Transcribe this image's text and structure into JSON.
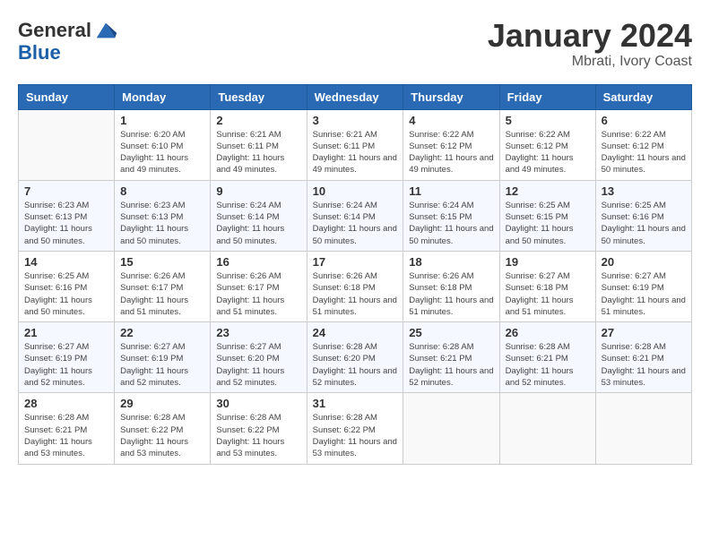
{
  "logo": {
    "general": "General",
    "blue": "Blue"
  },
  "header": {
    "month_year": "January 2024",
    "location": "Mbrati, Ivory Coast"
  },
  "weekdays": [
    "Sunday",
    "Monday",
    "Tuesday",
    "Wednesday",
    "Thursday",
    "Friday",
    "Saturday"
  ],
  "weeks": [
    [
      {
        "day": "",
        "sunrise": "",
        "sunset": "",
        "daylight": ""
      },
      {
        "day": "1",
        "sunrise": "6:20 AM",
        "sunset": "6:10 PM",
        "daylight": "11 hours and 49 minutes."
      },
      {
        "day": "2",
        "sunrise": "6:21 AM",
        "sunset": "6:11 PM",
        "daylight": "11 hours and 49 minutes."
      },
      {
        "day": "3",
        "sunrise": "6:21 AM",
        "sunset": "6:11 PM",
        "daylight": "11 hours and 49 minutes."
      },
      {
        "day": "4",
        "sunrise": "6:22 AM",
        "sunset": "6:12 PM",
        "daylight": "11 hours and 49 minutes."
      },
      {
        "day": "5",
        "sunrise": "6:22 AM",
        "sunset": "6:12 PM",
        "daylight": "11 hours and 49 minutes."
      },
      {
        "day": "6",
        "sunrise": "6:22 AM",
        "sunset": "6:12 PM",
        "daylight": "11 hours and 50 minutes."
      }
    ],
    [
      {
        "day": "7",
        "sunrise": "6:23 AM",
        "sunset": "6:13 PM",
        "daylight": "11 hours and 50 minutes."
      },
      {
        "day": "8",
        "sunrise": "6:23 AM",
        "sunset": "6:13 PM",
        "daylight": "11 hours and 50 minutes."
      },
      {
        "day": "9",
        "sunrise": "6:24 AM",
        "sunset": "6:14 PM",
        "daylight": "11 hours and 50 minutes."
      },
      {
        "day": "10",
        "sunrise": "6:24 AM",
        "sunset": "6:14 PM",
        "daylight": "11 hours and 50 minutes."
      },
      {
        "day": "11",
        "sunrise": "6:24 AM",
        "sunset": "6:15 PM",
        "daylight": "11 hours and 50 minutes."
      },
      {
        "day": "12",
        "sunrise": "6:25 AM",
        "sunset": "6:15 PM",
        "daylight": "11 hours and 50 minutes."
      },
      {
        "day": "13",
        "sunrise": "6:25 AM",
        "sunset": "6:16 PM",
        "daylight": "11 hours and 50 minutes."
      }
    ],
    [
      {
        "day": "14",
        "sunrise": "6:25 AM",
        "sunset": "6:16 PM",
        "daylight": "11 hours and 50 minutes."
      },
      {
        "day": "15",
        "sunrise": "6:26 AM",
        "sunset": "6:17 PM",
        "daylight": "11 hours and 51 minutes."
      },
      {
        "day": "16",
        "sunrise": "6:26 AM",
        "sunset": "6:17 PM",
        "daylight": "11 hours and 51 minutes."
      },
      {
        "day": "17",
        "sunrise": "6:26 AM",
        "sunset": "6:18 PM",
        "daylight": "11 hours and 51 minutes."
      },
      {
        "day": "18",
        "sunrise": "6:26 AM",
        "sunset": "6:18 PM",
        "daylight": "11 hours and 51 minutes."
      },
      {
        "day": "19",
        "sunrise": "6:27 AM",
        "sunset": "6:18 PM",
        "daylight": "11 hours and 51 minutes."
      },
      {
        "day": "20",
        "sunrise": "6:27 AM",
        "sunset": "6:19 PM",
        "daylight": "11 hours and 51 minutes."
      }
    ],
    [
      {
        "day": "21",
        "sunrise": "6:27 AM",
        "sunset": "6:19 PM",
        "daylight": "11 hours and 52 minutes."
      },
      {
        "day": "22",
        "sunrise": "6:27 AM",
        "sunset": "6:19 PM",
        "daylight": "11 hours and 52 minutes."
      },
      {
        "day": "23",
        "sunrise": "6:27 AM",
        "sunset": "6:20 PM",
        "daylight": "11 hours and 52 minutes."
      },
      {
        "day": "24",
        "sunrise": "6:28 AM",
        "sunset": "6:20 PM",
        "daylight": "11 hours and 52 minutes."
      },
      {
        "day": "25",
        "sunrise": "6:28 AM",
        "sunset": "6:21 PM",
        "daylight": "11 hours and 52 minutes."
      },
      {
        "day": "26",
        "sunrise": "6:28 AM",
        "sunset": "6:21 PM",
        "daylight": "11 hours and 52 minutes."
      },
      {
        "day": "27",
        "sunrise": "6:28 AM",
        "sunset": "6:21 PM",
        "daylight": "11 hours and 53 minutes."
      }
    ],
    [
      {
        "day": "28",
        "sunrise": "6:28 AM",
        "sunset": "6:21 PM",
        "daylight": "11 hours and 53 minutes."
      },
      {
        "day": "29",
        "sunrise": "6:28 AM",
        "sunset": "6:22 PM",
        "daylight": "11 hours and 53 minutes."
      },
      {
        "day": "30",
        "sunrise": "6:28 AM",
        "sunset": "6:22 PM",
        "daylight": "11 hours and 53 minutes."
      },
      {
        "day": "31",
        "sunrise": "6:28 AM",
        "sunset": "6:22 PM",
        "daylight": "11 hours and 53 minutes."
      },
      {
        "day": "",
        "sunrise": "",
        "sunset": "",
        "daylight": ""
      },
      {
        "day": "",
        "sunrise": "",
        "sunset": "",
        "daylight": ""
      },
      {
        "day": "",
        "sunrise": "",
        "sunset": "",
        "daylight": ""
      }
    ]
  ],
  "labels": {
    "sunrise": "Sunrise:",
    "sunset": "Sunset:",
    "daylight": "Daylight:"
  }
}
